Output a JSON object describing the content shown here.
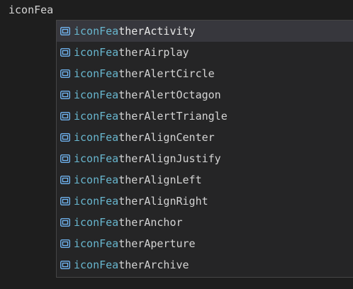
{
  "editor": {
    "typed_text": "iconFea"
  },
  "suggestions": {
    "match": "iconFea",
    "kind_icon": "variable-icon",
    "colors": {
      "match_highlight": "#68b6ce",
      "icon": "#75beff",
      "focused_background": "#37373d",
      "widget_background": "#252526"
    },
    "items": [
      {
        "match": "iconFea",
        "rest": "therActivity",
        "focused": true
      },
      {
        "match": "iconFea",
        "rest": "therAirplay"
      },
      {
        "match": "iconFea",
        "rest": "therAlertCircle"
      },
      {
        "match": "iconFea",
        "rest": "therAlertOctagon"
      },
      {
        "match": "iconFea",
        "rest": "therAlertTriangle"
      },
      {
        "match": "iconFea",
        "rest": "therAlignCenter"
      },
      {
        "match": "iconFea",
        "rest": "therAlignJustify"
      },
      {
        "match": "iconFea",
        "rest": "therAlignLeft"
      },
      {
        "match": "iconFea",
        "rest": "therAlignRight"
      },
      {
        "match": "iconFea",
        "rest": "therAnchor"
      },
      {
        "match": "iconFea",
        "rest": "therAperture"
      },
      {
        "match": "iconFea",
        "rest": "therArchive"
      }
    ]
  }
}
